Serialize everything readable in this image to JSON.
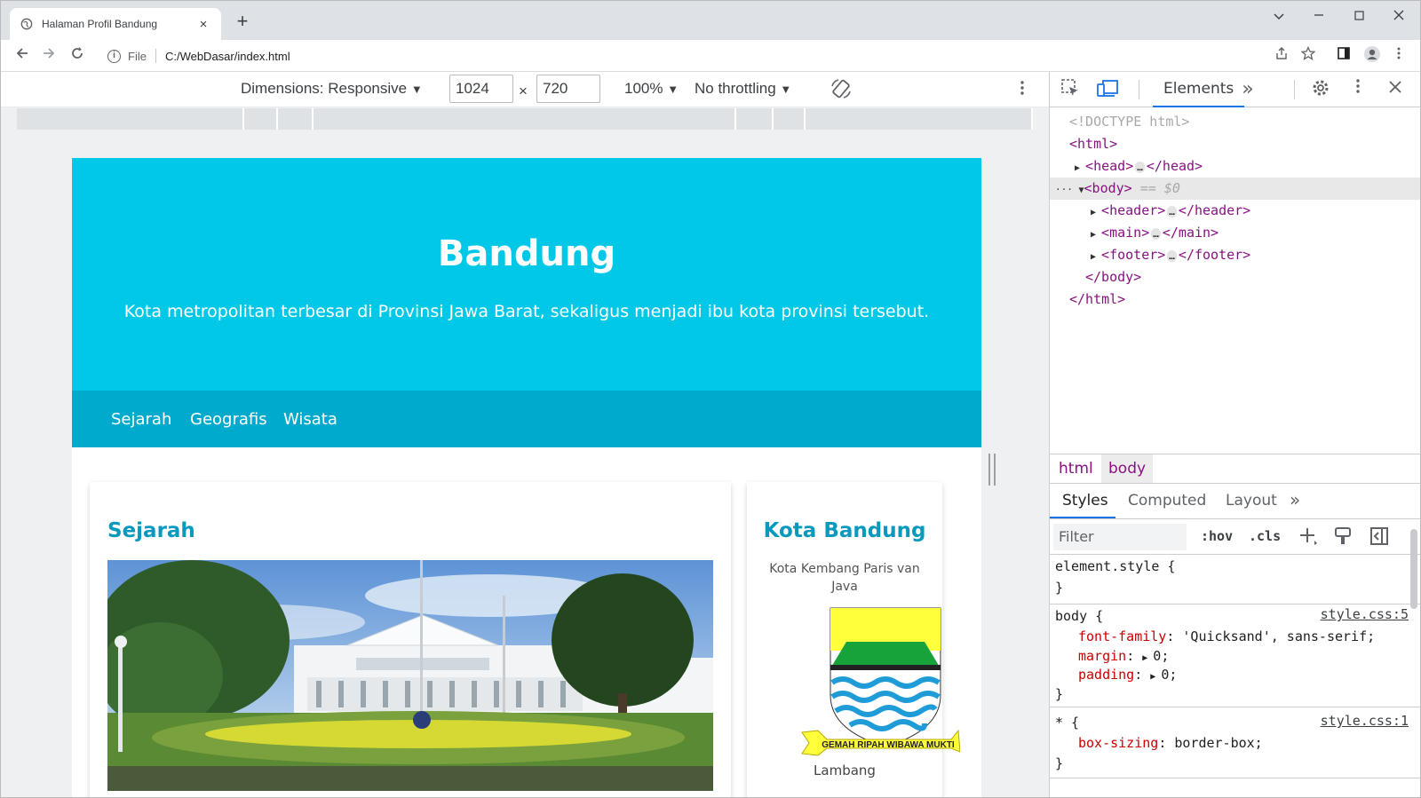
{
  "browser": {
    "tab_title": "Halaman Profil Bandung",
    "tab_close": "×",
    "new_tab": "+",
    "url_scheme": "File",
    "url_path": "C:/WebDasar/index.html"
  },
  "device_toolbar": {
    "dimensions": "Dimensions: Responsive",
    "width": "1024",
    "times": "×",
    "height": "720",
    "zoom": "100%",
    "throttling": "No throttling",
    "dropdown_glyph": "▼"
  },
  "page": {
    "title": "Bandung",
    "subtitle": "Kota metropolitan terbesar di Provinsi Jawa Barat, sekaligus menjadi ibu kota provinsi tersebut.",
    "nav": [
      "Sejarah",
      "Geografis",
      "Wisata"
    ],
    "article_heading": "Sejarah",
    "aside_heading": "Kota Bandung",
    "aside_subtitle": "Kota Kembang Paris van Java",
    "emblem_motto": "GEMAH RIPAH WIBAWA MUKTI",
    "emblem_caption": "Lambang"
  },
  "devtools": {
    "active_tab": "Elements",
    "more": "»",
    "tree": {
      "doctype": "<!DOCTYPE html>",
      "html_open": "<html>",
      "head": "<head>",
      "head_close": "</head>",
      "body": "<body>",
      "body_eq": "== $0",
      "header": "<header>",
      "header_close": "</header>",
      "main": "<main>",
      "main_close": "</main>",
      "footer": "<footer>",
      "footer_close": "</footer>",
      "body_close": "</body>",
      "html_close": "</html>",
      "ellipsis": "…"
    },
    "breadcrumbs": [
      "html",
      "body"
    ],
    "styles_tabs": [
      "Styles",
      "Computed",
      "Layout"
    ],
    "filter_placeholder": "Filter",
    "hov": ":hov",
    "cls": ".cls",
    "rules": {
      "element_style": "element.style {",
      "close": "}",
      "body_selector": "body {",
      "body_source": "style.css:5",
      "font_family_prop": "font-family",
      "font_family_val": "'Quicksand', sans-serif;",
      "margin_prop": "margin",
      "margin_val": "0;",
      "padding_prop": "padding",
      "padding_val": "0;",
      "star_selector": "* {",
      "star_source": "style.css:1",
      "box_sizing_prop": "box-sizing",
      "box_sizing_val": "border-box;"
    }
  },
  "colors": {
    "header_bg": "#00c8e6",
    "nav_bg": "#00aacc",
    "heading": "#0899bd",
    "devtools_accent": "#1a73e8"
  }
}
